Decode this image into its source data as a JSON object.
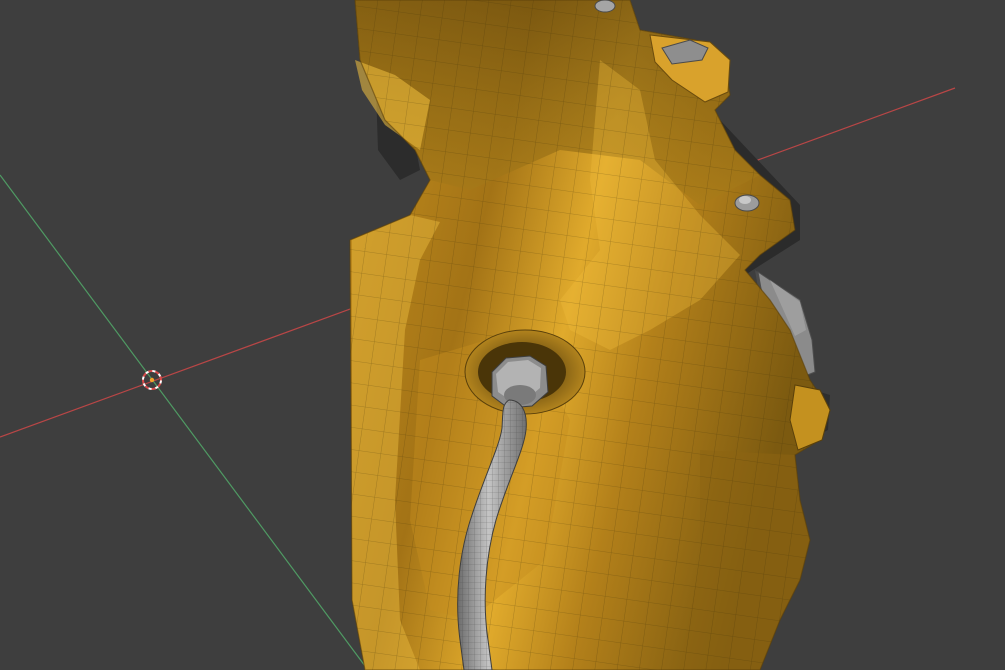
{
  "viewport": {
    "mode": "3d-viewport",
    "shading": "solid",
    "overlay_wireframe": true
  },
  "colors": {
    "background": "#3e3e3e",
    "x_axis": "#c24a4a",
    "y_axis": "#5e9a6a",
    "mesh_base": "#d8a22b",
    "mesh_shadow": "#6b4c0d",
    "mesh_highlight": "#f4c440",
    "mesh_wire": "#3a2a05",
    "metal": "#9a9a9a",
    "metal_dark": "#5e5e5e",
    "cursor_ring": "#e05050"
  },
  "objects": [
    {
      "name": "brake-caliper-body",
      "material": "yellow"
    },
    {
      "name": "brake-hose",
      "material": "metal"
    },
    {
      "name": "hose-fitting-nut",
      "material": "metal"
    },
    {
      "name": "mounting-bolts",
      "material": "metal"
    },
    {
      "name": "brake-pad-clip",
      "material": "metal"
    }
  ],
  "icons": {
    "cursor": "3d-cursor-icon"
  }
}
